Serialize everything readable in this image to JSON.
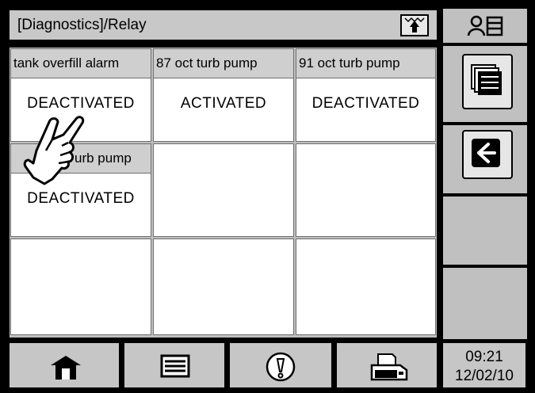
{
  "header": {
    "breadcrumb": "[Diagnostics]/Relay",
    "up_icon": "upload-arrow-icon"
  },
  "relays": [
    {
      "name": "tank overfill alarm",
      "status": "DEACTIVATED"
    },
    {
      "name": "87 oct  turb pump",
      "status": "ACTIVATED"
    },
    {
      "name": "91 oct turb pump",
      "status": "DEACTIVATED"
    },
    {
      "name": "urb pump",
      "status": "DEACTIVATED"
    }
  ],
  "sidebar": {
    "buttons": [
      {
        "icon": "user-list-icon"
      },
      {
        "icon": "list-view-icon"
      },
      {
        "icon": "back-arrow-icon"
      },
      {
        "icon": ""
      },
      {
        "icon": ""
      }
    ]
  },
  "footer": {
    "buttons": [
      {
        "icon": "home-icon"
      },
      {
        "icon": "menu-list-icon"
      },
      {
        "icon": "alarm-warning-icon"
      },
      {
        "icon": "printer-icon"
      }
    ],
    "time": "09:21",
    "date": "12/02/10"
  },
  "pointer": {
    "icon": "hand-pointer-icon"
  }
}
